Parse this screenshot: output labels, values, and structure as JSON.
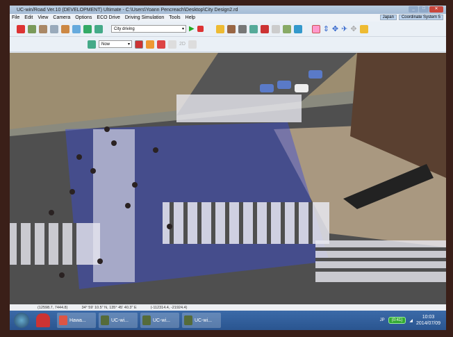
{
  "window": {
    "title": "UC-win/Road Ver.10 (DEVELOPMENT) Ultimate - C:\\Users\\Yoann Pencreach\\Desktop\\City Design2.rd"
  },
  "menu": [
    "File",
    "Edit",
    "View",
    "Camera",
    "Options",
    "ECO Drive",
    "Driving Simulation",
    "Tools",
    "Help"
  ],
  "menu_right": {
    "region": "Japan",
    "coord": "Coordinate System 5"
  },
  "toolbar": {
    "scenario": "City driving",
    "time": "Now",
    "label_2d": "2D"
  },
  "status": {
    "coords": "(12598.7, 7444.8)",
    "latlon": "34° 59' 10.5\" N, 135° 45' 40.3\" E",
    "offset": "(-112314.4, -21924.4)"
  },
  "taskbar": {
    "items": [
      "Hawa...",
      "UC-wi...",
      "UC-wi...",
      "UC-wi..."
    ],
    "ime": "JP",
    "timer": "(0:41)",
    "time": "10:03",
    "date": "2014/07/09"
  },
  "colors": {
    "accent": "#2a5590",
    "overlay": "#3a4bd8"
  }
}
